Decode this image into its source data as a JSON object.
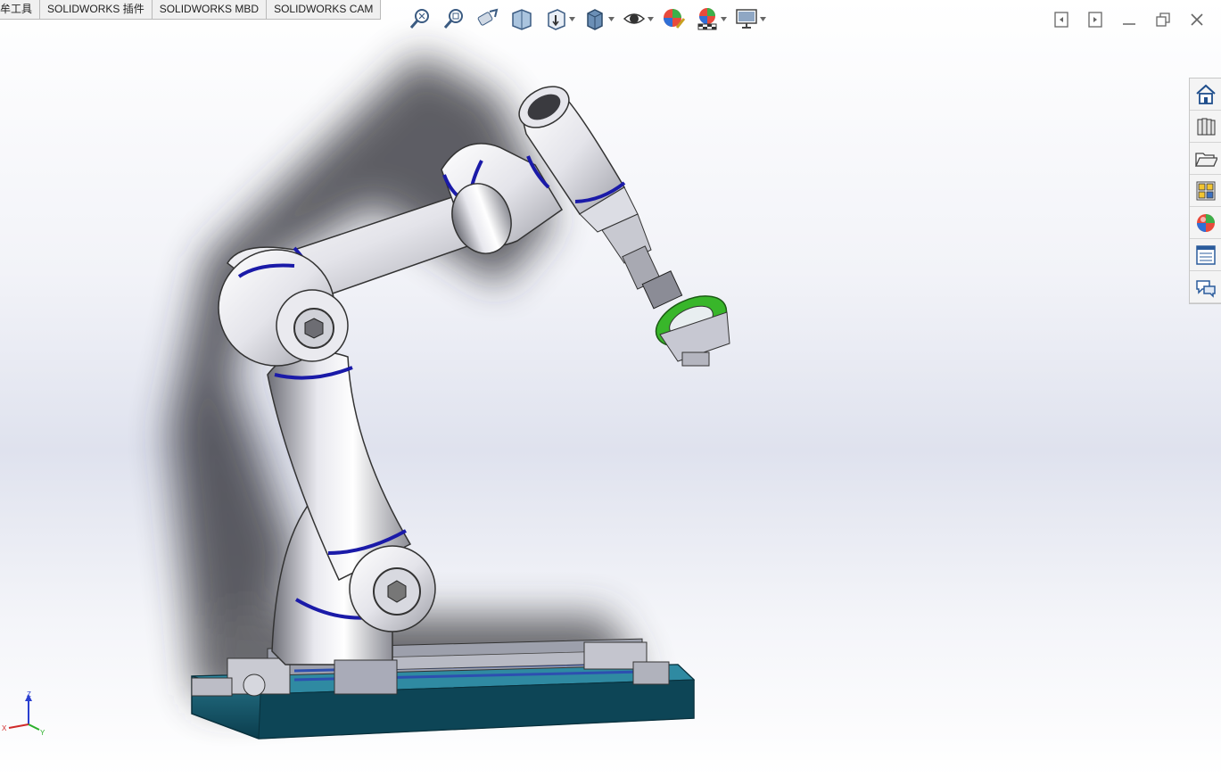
{
  "tabs": [
    {
      "label": "牟工具"
    },
    {
      "label": "SOLIDWORKS 插件"
    },
    {
      "label": "SOLIDWORKS MBD"
    },
    {
      "label": "SOLIDWORKS CAM"
    }
  ],
  "toolbar": {
    "icons": [
      "zoom-to-fit-icon",
      "zoom-to-area-icon",
      "previous-view-icon",
      "section-view-icon",
      "view-orientation-icon",
      "display-style-icon",
      "hide-show-items-icon",
      "edit-appearance-icon",
      "apply-scene-icon",
      "view-settings-icon"
    ]
  },
  "taskpane": {
    "icons": [
      "solidworks-resources-icon",
      "design-library-icon",
      "file-explorer-icon",
      "view-palette-icon",
      "appearances-scenes-icon",
      "custom-properties-icon",
      "forum-icon"
    ]
  },
  "triad": {
    "z_label": "Z",
    "x_label": "X",
    "y_label": "Y"
  },
  "colors": {
    "accent_blue": "#1a1aa8",
    "base_teal": "#0f4f63",
    "gripper_green": "#38b62a"
  }
}
